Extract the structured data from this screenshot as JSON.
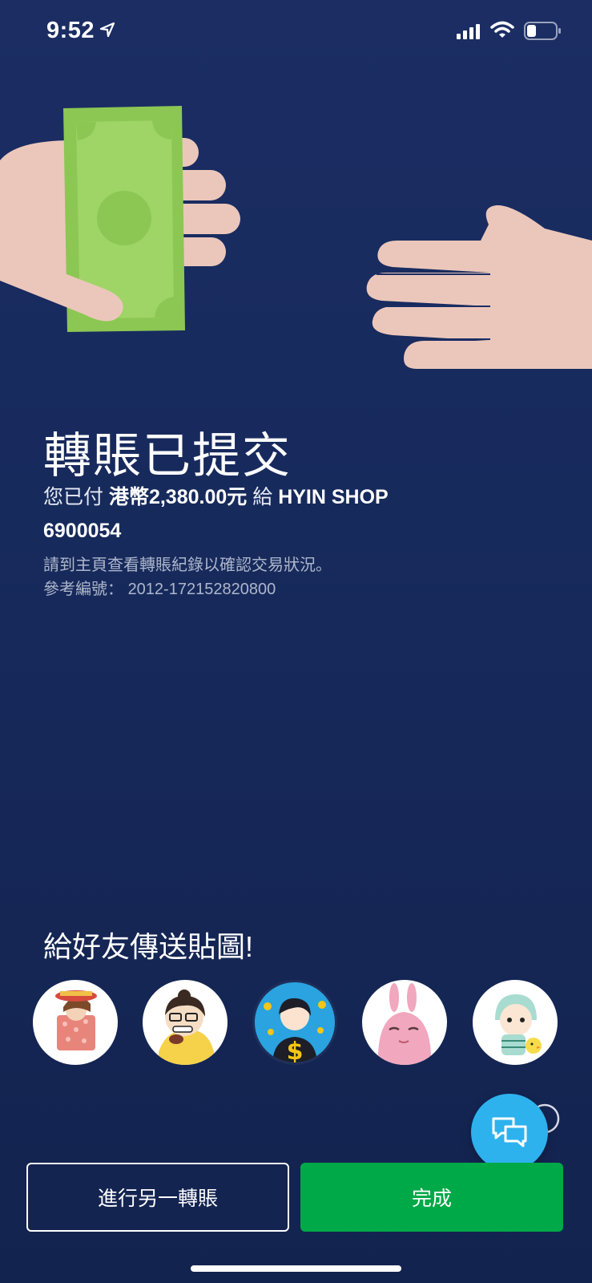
{
  "status_bar": {
    "time": "9:52",
    "icons": [
      "location-arrow-icon",
      "cellular-signal-icon",
      "wifi-icon",
      "battery-icon"
    ]
  },
  "hero": {
    "image": "hand-giving-money-illustration"
  },
  "result": {
    "title": "轉賬已提交",
    "paid_prefix": "您已付 ",
    "amount": "港幣2,380.00元",
    "to_word": " 給 ",
    "payee": "HYIN SHOP",
    "account": "6900054",
    "note": "請到主頁查看轉賬紀錄以確認交易狀況。",
    "reference_label": "參考編號：",
    "reference_number": "2012-172152820800"
  },
  "stickers": {
    "title": "給好友傳送貼圖!",
    "items": [
      {
        "name": "sticker-gift-box-girl"
      },
      {
        "name": "sticker-girl-with-glasses"
      },
      {
        "name": "sticker-money-man"
      },
      {
        "name": "sticker-pink-rabbit"
      },
      {
        "name": "sticker-baby-with-chick"
      }
    ]
  },
  "actions": {
    "another_transfer": "進行另一轉賬",
    "done": "完成"
  },
  "colors": {
    "background": "#1b2d63",
    "primary_green": "#00a948",
    "chat_blue": "#2db2ee"
  }
}
